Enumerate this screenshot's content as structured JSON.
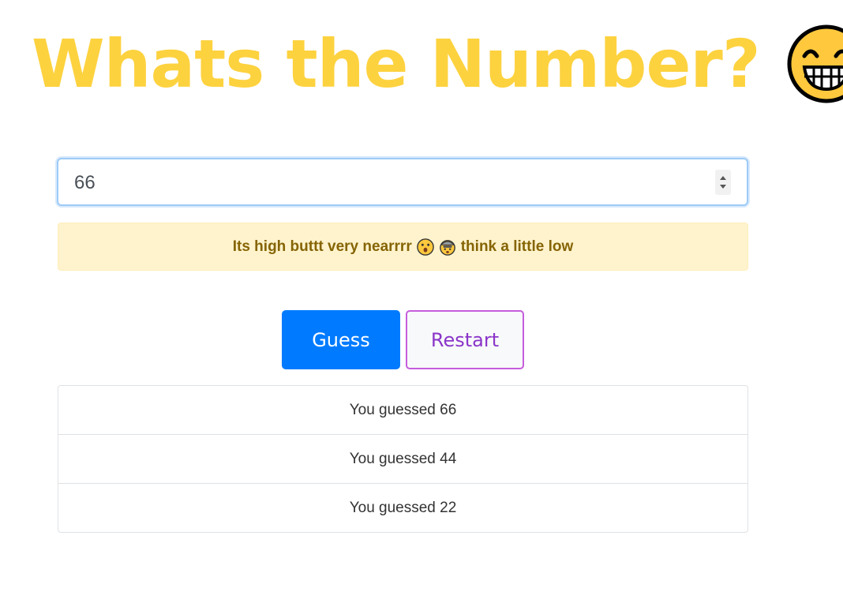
{
  "header": {
    "title": "Whats the Number?",
    "emoji": "grinning-face-icon"
  },
  "guess_input": {
    "value": "66"
  },
  "feedback": {
    "text_before": "Its high buttt very nearrrr",
    "icons": [
      "astonished-face-icon",
      "exploding-head-icon"
    ],
    "text_after": "think a little low"
  },
  "buttons": {
    "guess_label": "Guess",
    "restart_label": "Restart"
  },
  "history": [
    "You guessed 66",
    "You guessed 44",
    "You guessed 22"
  ],
  "colors": {
    "title": "#fdd23f",
    "primary": "#007bff",
    "restart_border": "#c65ddd",
    "restart_text": "#8a35c9",
    "alert_bg": "#fff3cd",
    "alert_text": "#856404"
  }
}
